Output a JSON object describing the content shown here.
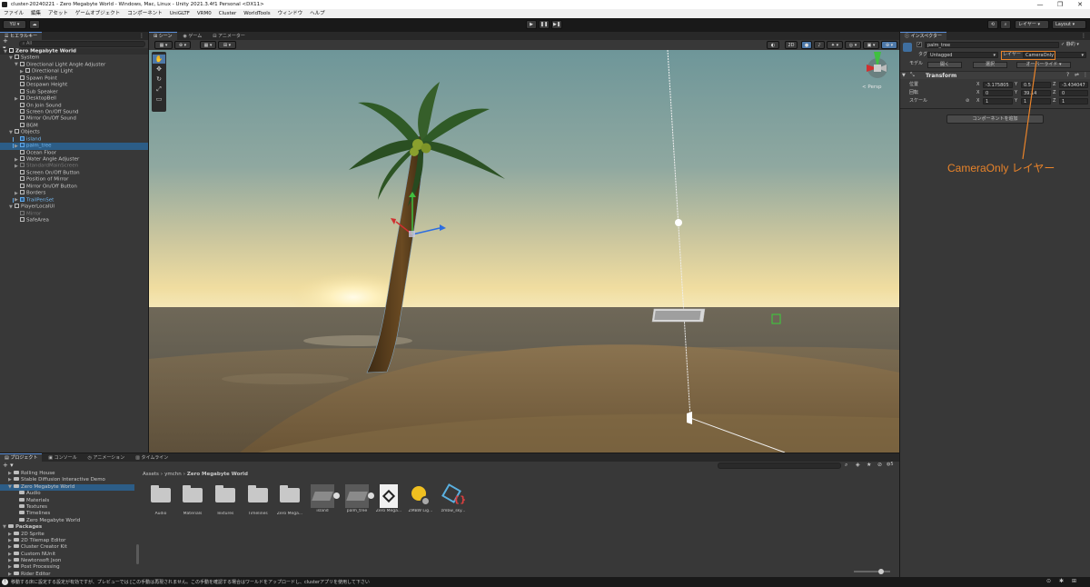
{
  "window": {
    "title": "cluster-20240221 - Zero Megabyte World - Windows, Mac, Linux - Unity 2021.3.4f1 Personal <DX11>",
    "controls": [
      "—",
      "❐",
      "✕"
    ]
  },
  "menu": [
    "ファイル",
    "編集",
    "アセット",
    "ゲームオブジェクト",
    "コンポーネント",
    "UniGLTF",
    "VRM0",
    "Cluster",
    "WorldTools",
    "ウィンドウ",
    "ヘルプ"
  ],
  "toolbar": {
    "account": "YU ▾",
    "play": "▶",
    "pause": "❚❚",
    "step": "▶❚",
    "layers": "レイヤー",
    "layout": "Layout"
  },
  "hierarchy": {
    "tab": "ヒエラルキー",
    "search_placeholder": "All",
    "scene": "Zero Megabyte World",
    "items": [
      {
        "label": "System",
        "indent": 1,
        "arrow": "▼",
        "style": "normal"
      },
      {
        "label": "Directional Light Angle Adjuster",
        "indent": 2,
        "arrow": "▼",
        "style": "normal"
      },
      {
        "label": "Directional Light",
        "indent": 3,
        "arrow": "▶",
        "style": "normal"
      },
      {
        "label": "Spawn Point",
        "indent": 2,
        "arrow": "",
        "style": "normal"
      },
      {
        "label": "Despawn Height",
        "indent": 2,
        "arrow": "",
        "style": "normal"
      },
      {
        "label": "Sub Speaker",
        "indent": 2,
        "arrow": "",
        "style": "normal"
      },
      {
        "label": "DesktopBell",
        "indent": 2,
        "arrow": "▶",
        "style": "normal"
      },
      {
        "label": "On Join Sound",
        "indent": 2,
        "arrow": "",
        "style": "normal"
      },
      {
        "label": "Screen On/Off Sound",
        "indent": 2,
        "arrow": "",
        "style": "normal"
      },
      {
        "label": "Mirror On/Off Sound",
        "indent": 2,
        "arrow": "",
        "style": "normal"
      },
      {
        "label": "BGM",
        "indent": 2,
        "arrow": "",
        "style": "normal"
      },
      {
        "label": "Objects",
        "indent": 1,
        "arrow": "▼",
        "style": "normal"
      },
      {
        "label": "island",
        "indent": 2,
        "arrow": "",
        "style": "blue"
      },
      {
        "label": "palm_tree",
        "indent": 2,
        "arrow": "▶",
        "style": "selected"
      },
      {
        "label": "Ocean Floor",
        "indent": 2,
        "arrow": "",
        "style": "normal"
      },
      {
        "label": "Water Angle Adjuster",
        "indent": 2,
        "arrow": "▶",
        "style": "normal"
      },
      {
        "label": "StandardMainScreen",
        "indent": 2,
        "arrow": "▶",
        "style": "dim"
      },
      {
        "label": "Screen On/Off Button",
        "indent": 2,
        "arrow": "",
        "style": "normal"
      },
      {
        "label": "Position of Mirror",
        "indent": 2,
        "arrow": "",
        "style": "normal"
      },
      {
        "label": "Mirror On/Off Button",
        "indent": 2,
        "arrow": "",
        "style": "normal"
      },
      {
        "label": "Borders",
        "indent": 2,
        "arrow": "▶",
        "style": "normal"
      },
      {
        "label": "TrailPenSet",
        "indent": 2,
        "arrow": "▶",
        "style": "blue"
      },
      {
        "label": "PlayerLocalUI",
        "indent": 1,
        "arrow": "▼",
        "style": "normal"
      },
      {
        "label": "Mirror",
        "indent": 2,
        "arrow": "",
        "style": "dim"
      },
      {
        "label": "SafeArea",
        "indent": 2,
        "arrow": "",
        "style": "normal"
      }
    ]
  },
  "scene_view": {
    "tabs": [
      "シーン",
      "ゲーム",
      "アニメーター"
    ],
    "toolbar_value": "2D",
    "persp_label": "< Persp"
  },
  "inspector": {
    "tab": "インスペクター",
    "object_name": "palm_tree",
    "static_label": "静的",
    "tag_label": "タグ",
    "tag_value": "Untagged",
    "layer_label": "レイヤー",
    "layer_value": "CameraOnly",
    "model_label": "モデル",
    "open_label": "開く",
    "select_label": "選択",
    "overrides_label": "オーバーライド",
    "transform_title": "Transform",
    "position_label": "位置",
    "rotation_label": "回転",
    "scale_label": "スケール",
    "position": {
      "x": "-3.175805",
      "y": "0.5",
      "z": "-3.434047"
    },
    "rotation": {
      "x": "0",
      "y": "39.14",
      "z": "0"
    },
    "scale": {
      "x": "1",
      "y": "1",
      "z": "1"
    },
    "add_component": "コンポーネントを追加",
    "annotation": "CameraOnly レイヤー",
    "annotation_color": "#e8832a"
  },
  "project": {
    "tabs": [
      "プロジェクト",
      "コンソール",
      "アニメーション",
      "タイムライン"
    ],
    "breadcrumb": [
      "Assets",
      "ymchn",
      "Zero Megabyte World"
    ],
    "count": "5",
    "tree": [
      {
        "label": "Rolling House",
        "indent": 1,
        "arrow": "▶"
      },
      {
        "label": "Stable Diffusion Interactive Demo",
        "indent": 1,
        "arrow": "▶"
      },
      {
        "label": "Zero Megabyte World",
        "indent": 1,
        "arrow": "▼"
      },
      {
        "label": "Audio",
        "indent": 2,
        "arrow": ""
      },
      {
        "label": "Materials",
        "indent": 2,
        "arrow": ""
      },
      {
        "label": "Textures",
        "indent": 2,
        "arrow": ""
      },
      {
        "label": "Timelines",
        "indent": 2,
        "arrow": ""
      },
      {
        "label": "Zero Megabyte World",
        "indent": 2,
        "arrow": ""
      },
      {
        "label": "Packages",
        "indent": 0,
        "arrow": "▼"
      },
      {
        "label": "2D Sprite",
        "indent": 1,
        "arrow": "▶"
      },
      {
        "label": "2D Tilemap Editor",
        "indent": 1,
        "arrow": "▶"
      },
      {
        "label": "Cluster Creator Kit",
        "indent": 1,
        "arrow": "▶"
      },
      {
        "label": "Custom NUnit",
        "indent": 1,
        "arrow": "▶"
      },
      {
        "label": "Newtonsoft Json",
        "indent": 1,
        "arrow": "▶"
      },
      {
        "label": "Post Processing",
        "indent": 1,
        "arrow": "▶"
      },
      {
        "label": "Rider Editor",
        "indent": 1,
        "arrow": "▶"
      }
    ],
    "assets": [
      {
        "label": "Audio",
        "kind": "folder"
      },
      {
        "label": "Materials",
        "kind": "folder"
      },
      {
        "label": "Textures",
        "kind": "folder"
      },
      {
        "label": "Timelines",
        "kind": "folder"
      },
      {
        "label": "Zero Mega...",
        "kind": "folder"
      },
      {
        "label": "island",
        "kind": "model"
      },
      {
        "label": "palm_tree",
        "kind": "model"
      },
      {
        "label": "Zero Mega...",
        "kind": "unity-scene"
      },
      {
        "label": "ZMBW Lig...",
        "kind": "lighting"
      },
      {
        "label": "zmbw_sky...",
        "kind": "shader"
      }
    ]
  },
  "status_bar": {
    "message": "移動する床に設定する設定が有効ですが、プレビューでは [この手動は再現されません。この手動を確認する場合はワールドをアップロードし、clusterアプリを使用して下さい"
  }
}
